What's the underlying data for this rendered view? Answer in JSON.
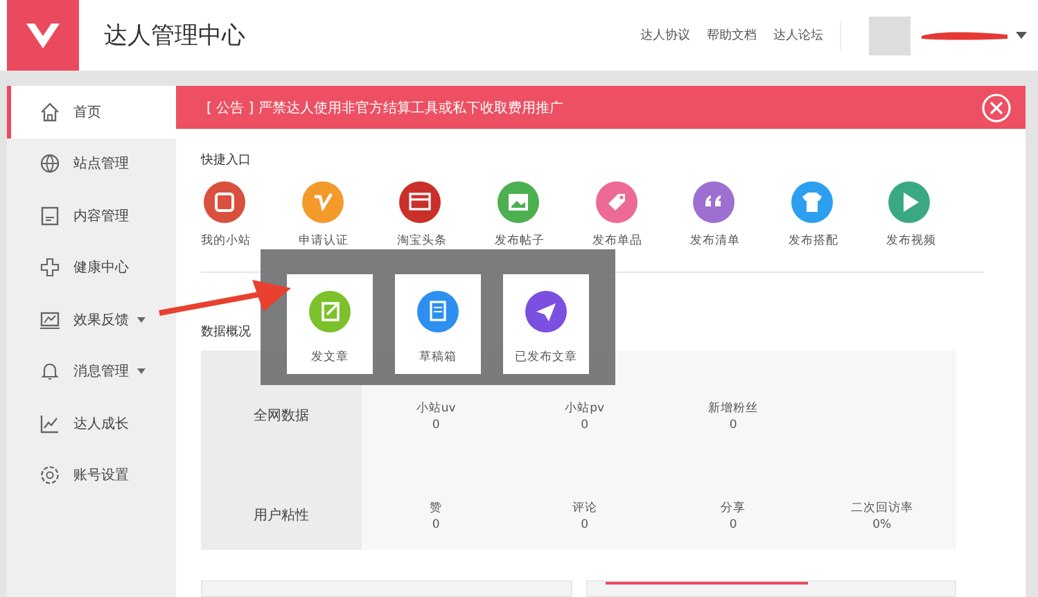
{
  "header": {
    "title": "达人管理中心",
    "links": [
      "达人协议",
      "帮助文档",
      "达人论坛"
    ]
  },
  "sidebar": {
    "items": [
      {
        "label": "首页",
        "selected": true,
        "has_submenu": false
      },
      {
        "label": "站点管理",
        "selected": false,
        "has_submenu": false
      },
      {
        "label": "内容管理",
        "selected": false,
        "has_submenu": false
      },
      {
        "label": "健康中心",
        "selected": false,
        "has_submenu": false
      },
      {
        "label": "效果反馈",
        "selected": false,
        "has_submenu": true
      },
      {
        "label": "消息管理",
        "selected": false,
        "has_submenu": true
      },
      {
        "label": "达人成长",
        "selected": false,
        "has_submenu": false
      },
      {
        "label": "账号设置",
        "selected": false,
        "has_submenu": false
      }
    ]
  },
  "notice": {
    "text": "[ 公告 ] 严禁达人使用非官方结算工具或私下收取费用推广"
  },
  "quick_entry": {
    "title": "快捷入口",
    "items": [
      {
        "label": "我的小站",
        "color": "#d9503f"
      },
      {
        "label": "申请认证",
        "color": "#f39a2b"
      },
      {
        "label": "淘宝头条",
        "color": "#c9302c"
      },
      {
        "label": "发布帖子",
        "color": "#4caf50"
      },
      {
        "label": "发布单品",
        "color": "#ec6a93"
      },
      {
        "label": "发布清单",
        "color": "#9c6fd0"
      },
      {
        "label": "发布搭配",
        "color": "#2d9ff0"
      },
      {
        "label": "发布视频",
        "color": "#3aa983"
      }
    ]
  },
  "data_overview": {
    "title": "数据概况",
    "rows": [
      {
        "label": "全网数据",
        "cells": [
          {
            "label": "小站uv",
            "value": "0"
          },
          {
            "label": "小站pv",
            "value": "0"
          },
          {
            "label": "新增粉丝",
            "value": "0"
          }
        ]
      },
      {
        "label": "用户粘性",
        "cells": [
          {
            "label": "赞",
            "value": "0"
          },
          {
            "label": "评论",
            "value": "0"
          },
          {
            "label": "分享",
            "value": "0"
          },
          {
            "label": "二次回访率",
            "value": "0%"
          }
        ]
      }
    ]
  },
  "popup": {
    "items": [
      {
        "label": "发文章",
        "color": "#7cc12a"
      },
      {
        "label": "草稿箱",
        "color": "#2d8ff0"
      },
      {
        "label": "已发布文章",
        "color": "#7b4fe0"
      }
    ]
  }
}
